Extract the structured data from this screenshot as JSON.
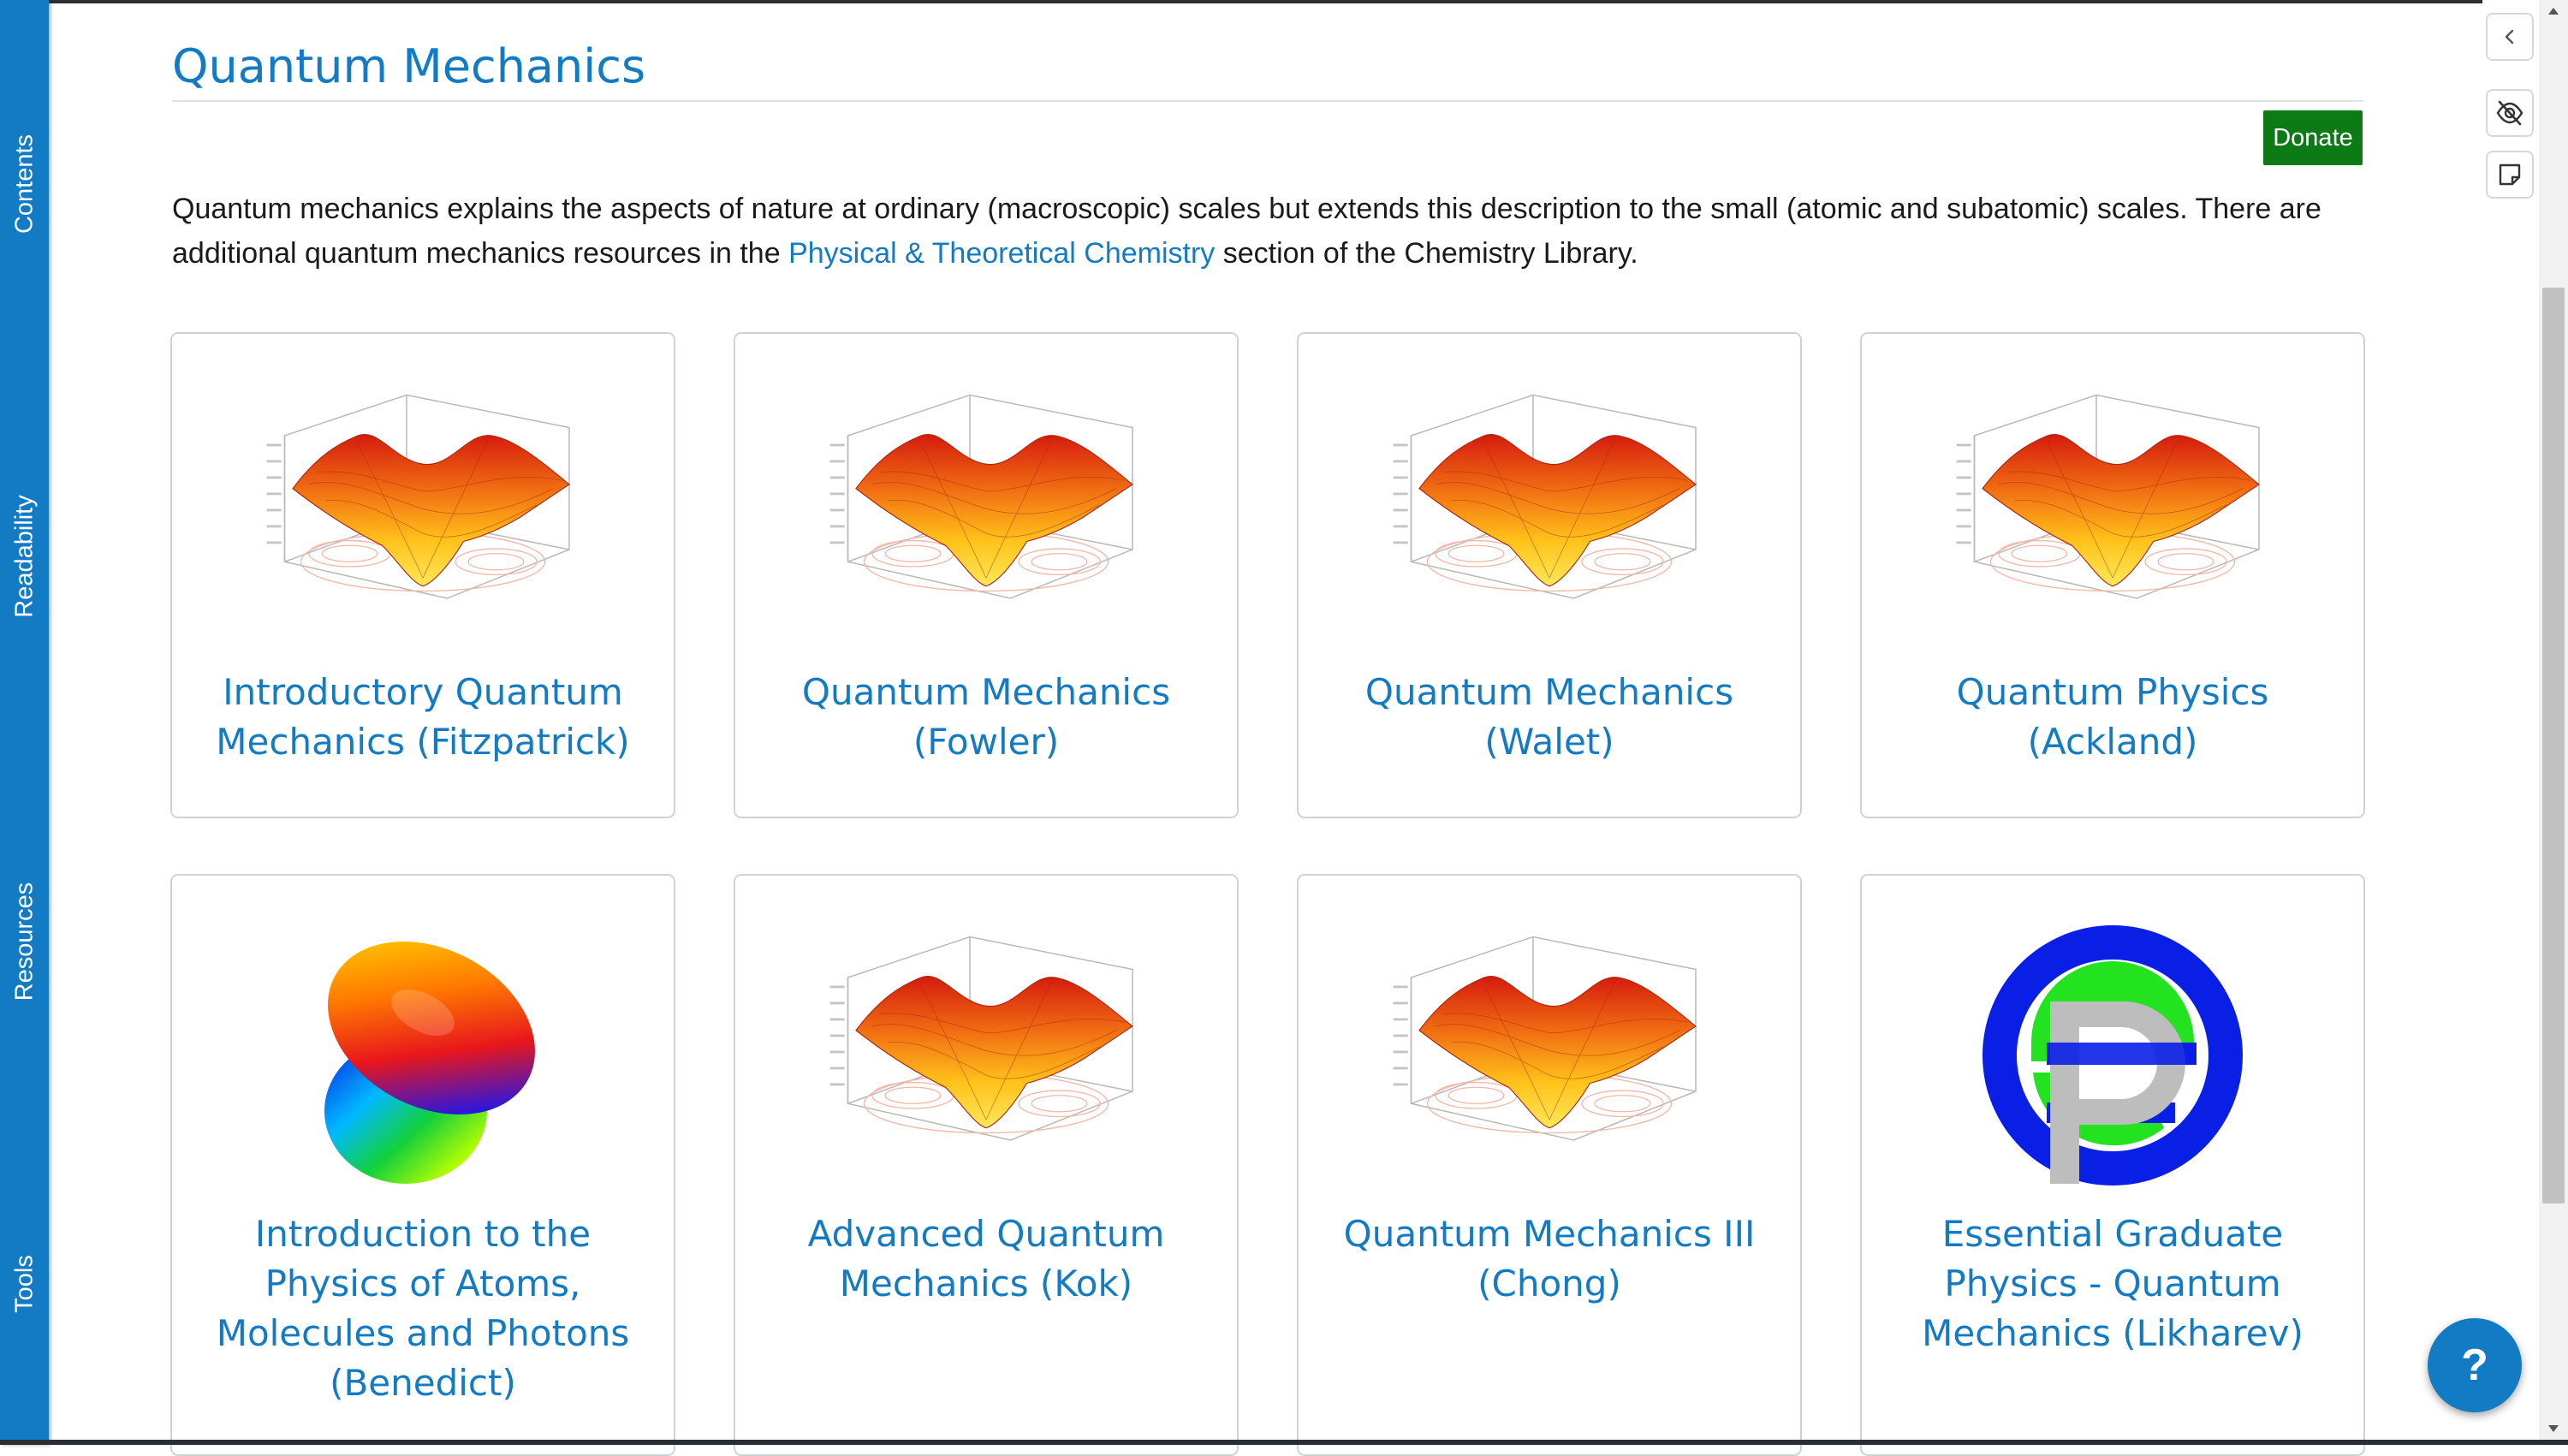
{
  "sidebar": {
    "tabs": [
      {
        "label": "Contents"
      },
      {
        "label": "Readability"
      },
      {
        "label": "Resources"
      },
      {
        "label": "Tools"
      }
    ]
  },
  "page": {
    "title": "Quantum Mechanics",
    "donate_label": "Donate",
    "intro_part1": "Quantum mechanics explains the aspects of nature at ordinary (macroscopic) scales but extends this description to the small (atomic and subatomic) scales. There are additional quantum mechanics resources in the ",
    "intro_link": "Physical & Theoretical Chemistry",
    "intro_part2": " section of the Chemistry Library."
  },
  "cards": [
    {
      "title": "Introductory Quantum Mechanics (Fitzpatrick)",
      "icon": "surface-plot-icon"
    },
    {
      "title": "Quantum Mechanics (Fowler)",
      "icon": "surface-plot-icon"
    },
    {
      "title": "Quantum Mechanics (Walet)",
      "icon": "surface-plot-icon"
    },
    {
      "title": "Quantum Physics (Ackland)",
      "icon": "surface-plot-icon"
    },
    {
      "title": "Introduction to the Physics of Atoms, Molecules and Photons (Benedict)",
      "icon": "orbital-icon"
    },
    {
      "title": "Advanced Quantum Mechanics (Kok)",
      "icon": "surface-plot-icon"
    },
    {
      "title": "Quantum Mechanics III (Chong)",
      "icon": "surface-plot-icon"
    },
    {
      "title": "Essential Graduate Physics - Quantum Mechanics (Likharev)",
      "icon": "egp-logo-icon"
    }
  ],
  "rail": {
    "buttons": [
      {
        "icon": "chevron-left-icon"
      },
      {
        "icon": "eye-off-icon"
      },
      {
        "icon": "sticky-note-icon"
      }
    ]
  },
  "help_label": "?",
  "colors": {
    "brand_blue": "#127bc4",
    "donate_green": "#0c7b16",
    "text": "#1a1a1a"
  }
}
